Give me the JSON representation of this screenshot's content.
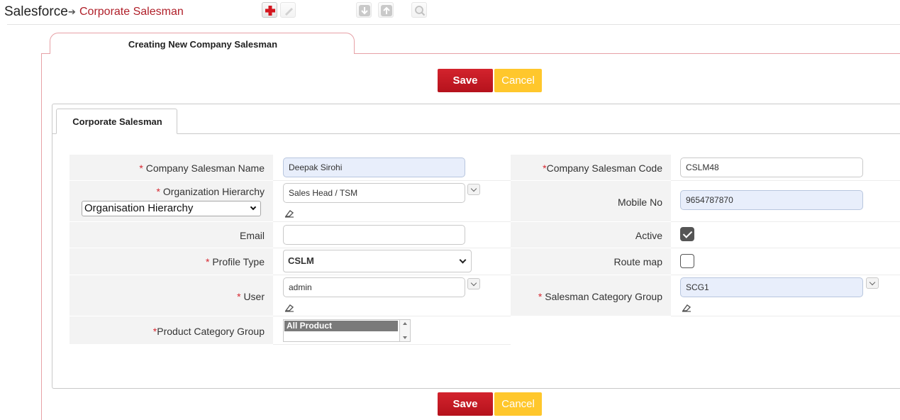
{
  "breadcrumb": {
    "root": "Salesforce",
    "separator": "➔",
    "current": "Corporate Salesman"
  },
  "toolbar": {
    "icons": [
      "add-icon",
      "edit-icon",
      "download-icon",
      "upload-icon",
      "zoom-icon"
    ]
  },
  "main_tab": {
    "label": "Creating New Company Salesman"
  },
  "actions": {
    "save_label": "Save",
    "cancel_label": "Cancel"
  },
  "inner_tab": {
    "label": "Corporate Salesman"
  },
  "form": {
    "company_salesman_name": {
      "required": "*",
      "label": "Company Salesman Name",
      "value": "Deepak Sirohi"
    },
    "company_salesman_code": {
      "required": "*",
      "label": "Company Salesman Code",
      "value": "CSLM48"
    },
    "organization_hierarchy": {
      "required": "*",
      "label": "Organization Hierarchy",
      "value": "Sales Head / TSM",
      "type_selected": "Organisation Hierarchy"
    },
    "mobile_no": {
      "label": "Mobile No",
      "value": "9654787870"
    },
    "email": {
      "label": "Email",
      "value": ""
    },
    "active": {
      "label": "Active",
      "checked": true
    },
    "profile_type": {
      "required": "*",
      "label": "Profile Type",
      "value": "CSLM"
    },
    "route_map": {
      "label": "Route map",
      "checked": false
    },
    "user": {
      "required": "*",
      "label": "User",
      "value": "admin"
    },
    "salesman_category_group": {
      "required": "*",
      "label": "Salesman Category Group",
      "value": "SCG1"
    },
    "product_category_group": {
      "required": "*",
      "label": "Product Category Group",
      "value": "All Product"
    }
  },
  "colors": {
    "save": "#c4161f",
    "cancel": "#ffc72c",
    "required": "#d6262f",
    "breadcrumb_current": "#b0202a",
    "tab_border": "#e7a1a6"
  }
}
